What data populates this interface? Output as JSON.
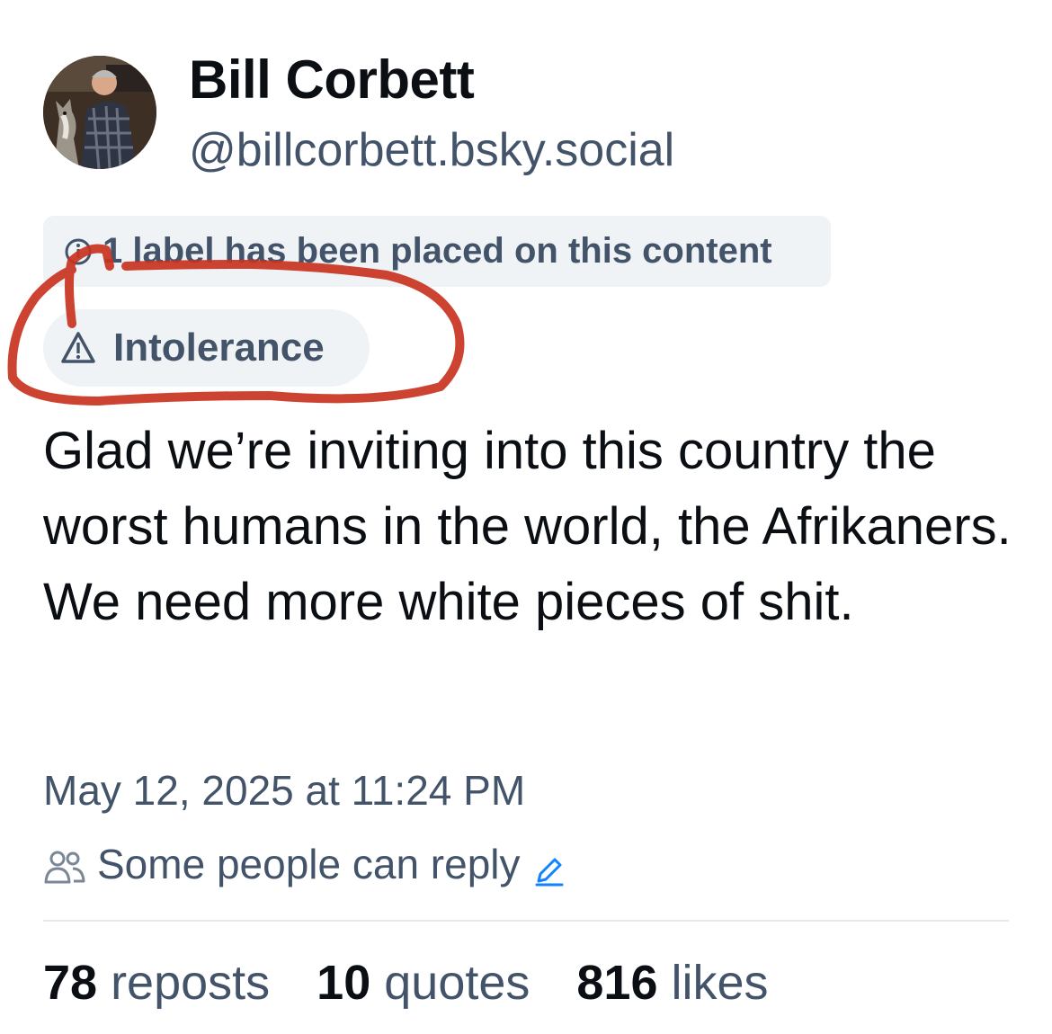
{
  "author": {
    "display_name": "Bill Corbett",
    "handle": "@billcorbett.bsky.social"
  },
  "moderation": {
    "notice_text": "1 label has been placed on this content",
    "label_name": "Intolerance",
    "notice_icon": "info-icon",
    "label_icon": "warning-triangle-icon"
  },
  "post": {
    "text": "Glad we’re inviting into this country the worst humans in the world, the Afrikaners. We need more white pieces of shit.",
    "timestamp": "May 12, 2025 at 11:24 PM"
  },
  "reply_setting": {
    "text": "Some people can reply",
    "icon": "people-icon",
    "edit_icon": "pencil-icon"
  },
  "stats": {
    "reposts_count": "78",
    "reposts_label": "reposts",
    "quotes_count": "10",
    "quotes_label": "quotes",
    "likes_count": "816",
    "likes_label": "likes"
  },
  "colors": {
    "text_primary": "#0b0f14",
    "text_secondary": "#43546a",
    "chip_bg": "#f0f3f6",
    "annotation_red": "#c9331f",
    "accent_blue": "#1083fe"
  }
}
